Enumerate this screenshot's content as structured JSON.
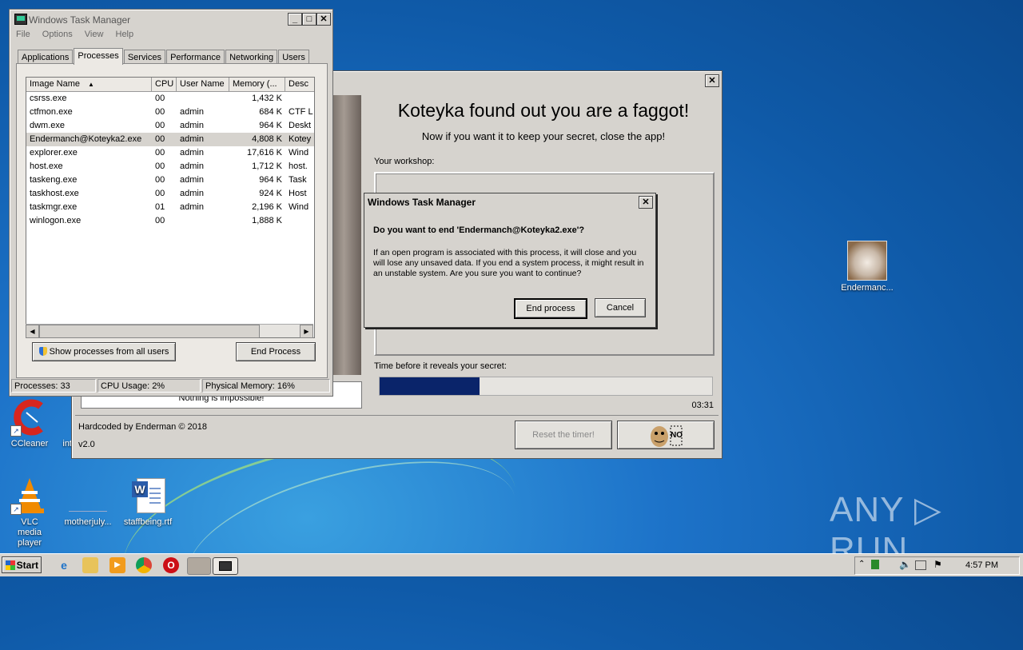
{
  "desktop": {
    "icons": [
      {
        "label": "CCleaner",
        "icon": "ccleaner-icon"
      },
      {
        "label": "int",
        "icon": "app-icon"
      },
      {
        "label": "VLC media player",
        "icon": "vlc-icon"
      },
      {
        "label": "motherjuly...",
        "icon": "file-icon"
      },
      {
        "label": "staffbeing.rtf",
        "icon": "word-document-icon"
      },
      {
        "label": "Endermanc...",
        "icon": "cat-photo-icon"
      }
    ],
    "watermark": "ANY ▷ RUN"
  },
  "koteyka": {
    "close": "✕",
    "headline": "Koteyka found out you are a faggot!",
    "subtitle": "Now if you want it to keep your secret, close the app!",
    "workshop_label": "Your workshop:",
    "timer_label": "Time before it reveals your secret:",
    "timer_progress": 0.3,
    "timer_value": "03:31",
    "photo_caption": "Nothing is impossible!",
    "credit": "Hardcoded by Enderman © 2018",
    "version": "v2.0",
    "reset_button": "Reset the timer!",
    "icon_button": "baldi-no-icon"
  },
  "taskmanager": {
    "title": "Windows Task Manager",
    "menu": [
      "File",
      "Options",
      "View",
      "Help"
    ],
    "tabs": [
      "Applications",
      "Processes",
      "Services",
      "Performance",
      "Networking",
      "Users"
    ],
    "active_tab": "Processes",
    "columns": [
      "Image Name",
      "CPU",
      "User Name",
      "Memory (...",
      "Desc"
    ],
    "rows": [
      {
        "name": "csrss.exe",
        "cpu": "00",
        "user": "",
        "mem": "1,432 K",
        "desc": ""
      },
      {
        "name": "ctfmon.exe",
        "cpu": "00",
        "user": "admin",
        "mem": "684 K",
        "desc": "CTF L"
      },
      {
        "name": "dwm.exe",
        "cpu": "00",
        "user": "admin",
        "mem": "964 K",
        "desc": "Deskt"
      },
      {
        "name": "Endermanch@Koteyka2.exe",
        "cpu": "00",
        "user": "admin",
        "mem": "4,808 K",
        "desc": "Kotey"
      },
      {
        "name": "explorer.exe",
        "cpu": "00",
        "user": "admin",
        "mem": "17,616 K",
        "desc": "Wind"
      },
      {
        "name": "host.exe",
        "cpu": "00",
        "user": "admin",
        "mem": "1,712 K",
        "desc": "host."
      },
      {
        "name": "taskeng.exe",
        "cpu": "00",
        "user": "admin",
        "mem": "964 K",
        "desc": "Task"
      },
      {
        "name": "taskhost.exe",
        "cpu": "00",
        "user": "admin",
        "mem": "924 K",
        "desc": "Host"
      },
      {
        "name": "taskmgr.exe",
        "cpu": "01",
        "user": "admin",
        "mem": "2,196 K",
        "desc": "Wind"
      },
      {
        "name": "winlogon.exe",
        "cpu": "00",
        "user": "",
        "mem": "1,888 K",
        "desc": ""
      }
    ],
    "selected_row": 3,
    "show_all_button": "Show processes from all users",
    "end_process_button": "End Process",
    "status": {
      "processes": "Processes: 33",
      "cpu": "CPU Usage: 2%",
      "memory": "Physical Memory: 16%"
    }
  },
  "dialog": {
    "title": "Windows Task Manager",
    "question": "Do you want to end 'Endermanch@Koteyka2.exe'?",
    "message": "If an open program is associated with this process, it will close and you will lose any unsaved data. If you end a system process, it might result in an unstable system. Are you sure you want to continue?",
    "ok_button": "End process",
    "cancel_button": "Cancel"
  },
  "taskbar": {
    "start_label": "Start",
    "pinned": [
      "ie-icon",
      "explorer-icon",
      "media-player-icon",
      "chrome-icon",
      "opera-icon",
      "koteyka-icon",
      "taskmgr-icon"
    ],
    "clock": "4:57 PM"
  }
}
